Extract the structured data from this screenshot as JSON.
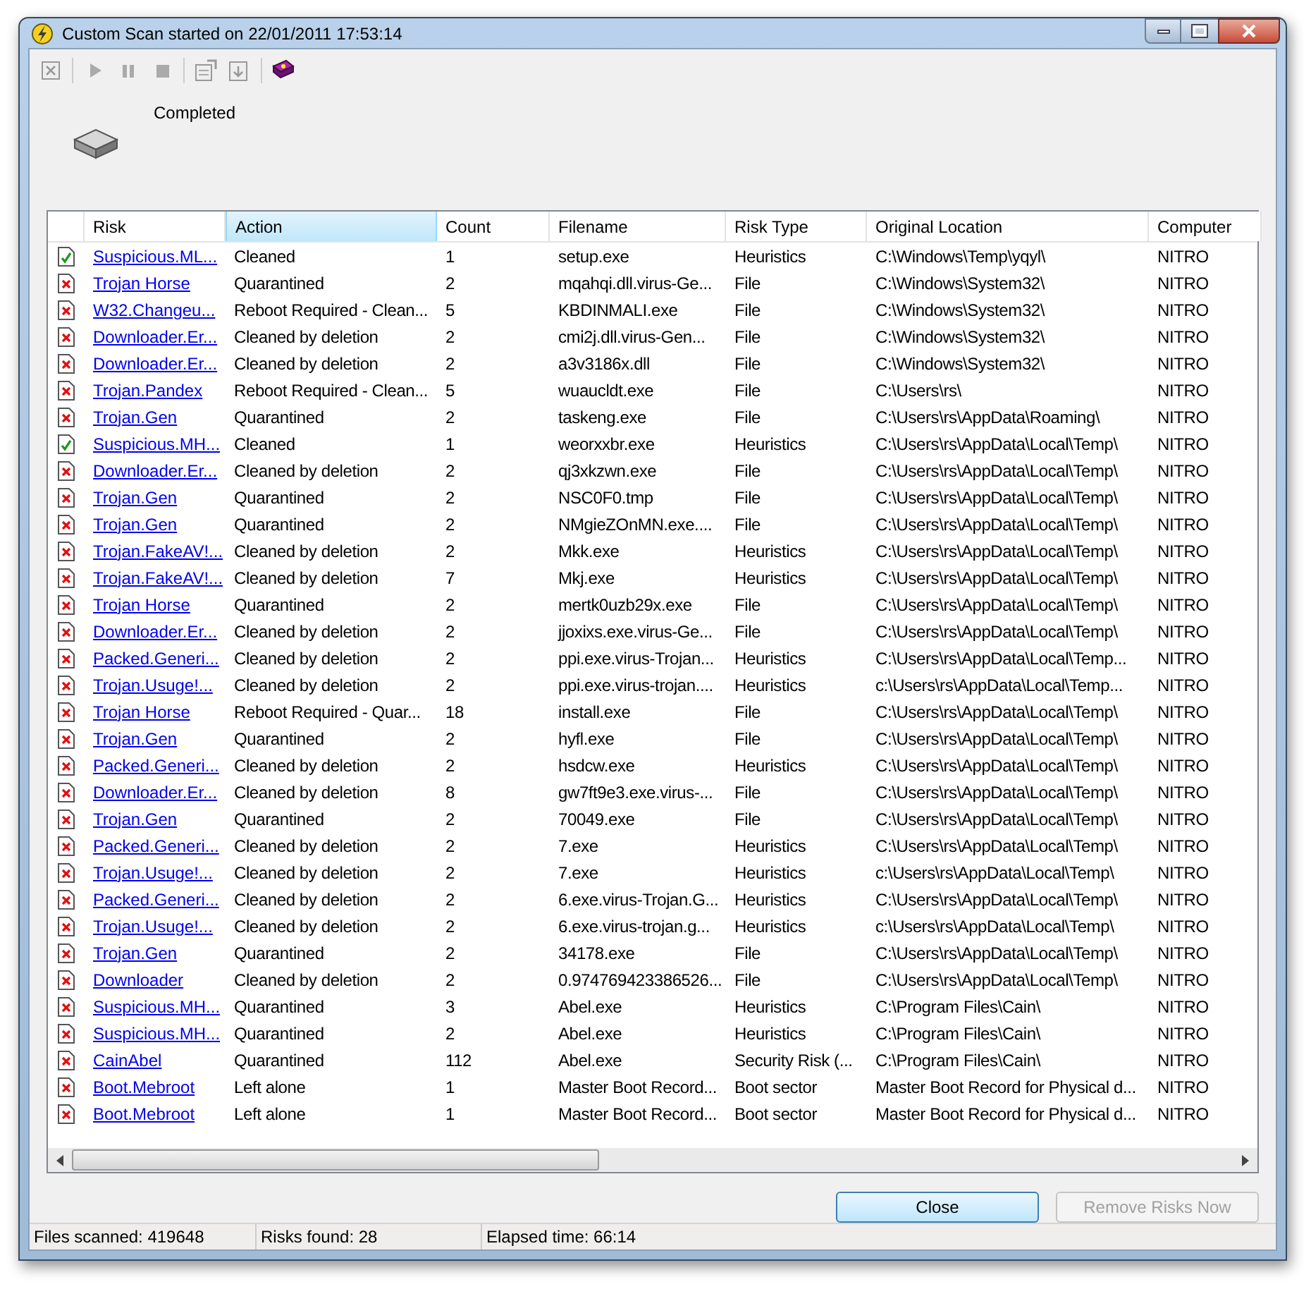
{
  "window": {
    "title": "Custom Scan started on 22/01/2011 17:53:14"
  },
  "status_text": "Completed",
  "table": {
    "columns": [
      {
        "label": "Risk",
        "selected": false
      },
      {
        "label": "Action",
        "selected": true
      },
      {
        "label": "Count",
        "selected": false
      },
      {
        "label": "Filename",
        "selected": false
      },
      {
        "label": "Risk Type",
        "selected": false
      },
      {
        "label": "Original Location",
        "selected": false
      },
      {
        "label": "Computer",
        "selected": false
      }
    ],
    "rows": [
      {
        "kind": "cleaned",
        "risk": "Suspicious.ML...",
        "action": "Cleaned",
        "count": "1",
        "filename": "setup.exe",
        "risk_type": "Heuristics",
        "location": "C:\\Windows\\Temp\\yqyl\\",
        "computer": "NITRO"
      },
      {
        "kind": "threat",
        "risk": "Trojan Horse",
        "action": "Quarantined",
        "count": "2",
        "filename": "mqahqi.dll.virus-Ge...",
        "risk_type": "File",
        "location": "C:\\Windows\\System32\\",
        "computer": "NITRO"
      },
      {
        "kind": "threat",
        "risk": "W32.Changeu...",
        "action": "Reboot Required - Clean...",
        "count": "5",
        "filename": "KBDINMALI.exe",
        "risk_type": "File",
        "location": "C:\\Windows\\System32\\",
        "computer": "NITRO"
      },
      {
        "kind": "threat",
        "risk": "Downloader.Er...",
        "action": "Cleaned by deletion",
        "count": "2",
        "filename": "cmi2j.dll.virus-Gen...",
        "risk_type": "File",
        "location": "C:\\Windows\\System32\\",
        "computer": "NITRO"
      },
      {
        "kind": "threat",
        "risk": "Downloader.Er...",
        "action": "Cleaned by deletion",
        "count": "2",
        "filename": "a3v3186x.dll",
        "risk_type": "File",
        "location": "C:\\Windows\\System32\\",
        "computer": "NITRO"
      },
      {
        "kind": "threat",
        "risk": "Trojan.Pandex",
        "action": "Reboot Required - Clean...",
        "count": "5",
        "filename": "wuaucldt.exe",
        "risk_type": "File",
        "location": "C:\\Users\\rs\\",
        "computer": "NITRO"
      },
      {
        "kind": "threat",
        "risk": "Trojan.Gen",
        "action": "Quarantined",
        "count": "2",
        "filename": "taskeng.exe",
        "risk_type": "File",
        "location": "C:\\Users\\rs\\AppData\\Roaming\\",
        "computer": "NITRO"
      },
      {
        "kind": "cleaned",
        "risk": "Suspicious.MH...",
        "action": "Cleaned",
        "count": "1",
        "filename": "weorxxbr.exe",
        "risk_type": "Heuristics",
        "location": "C:\\Users\\rs\\AppData\\Local\\Temp\\",
        "computer": "NITRO"
      },
      {
        "kind": "threat",
        "risk": "Downloader.Er...",
        "action": "Cleaned by deletion",
        "count": "2",
        "filename": "qj3xkzwn.exe",
        "risk_type": "File",
        "location": "C:\\Users\\rs\\AppData\\Local\\Temp\\",
        "computer": "NITRO"
      },
      {
        "kind": "threat",
        "risk": "Trojan.Gen",
        "action": "Quarantined",
        "count": "2",
        "filename": "NSC0F0.tmp",
        "risk_type": "File",
        "location": "C:\\Users\\rs\\AppData\\Local\\Temp\\",
        "computer": "NITRO"
      },
      {
        "kind": "threat",
        "risk": "Trojan.Gen",
        "action": "Quarantined",
        "count": "2",
        "filename": "NMgieZOnMN.exe....",
        "risk_type": "File",
        "location": "C:\\Users\\rs\\AppData\\Local\\Temp\\",
        "computer": "NITRO"
      },
      {
        "kind": "threat",
        "risk": "Trojan.FakeAV!...",
        "action": "Cleaned by deletion",
        "count": "2",
        "filename": "Mkk.exe",
        "risk_type": "Heuristics",
        "location": "C:\\Users\\rs\\AppData\\Local\\Temp\\",
        "computer": "NITRO"
      },
      {
        "kind": "threat",
        "risk": "Trojan.FakeAV!...",
        "action": "Cleaned by deletion",
        "count": "7",
        "filename": "Mkj.exe",
        "risk_type": "Heuristics",
        "location": "C:\\Users\\rs\\AppData\\Local\\Temp\\",
        "computer": "NITRO"
      },
      {
        "kind": "threat",
        "risk": "Trojan Horse",
        "action": "Quarantined",
        "count": "2",
        "filename": "mertk0uzb29x.exe",
        "risk_type": "File",
        "location": "C:\\Users\\rs\\AppData\\Local\\Temp\\",
        "computer": "NITRO"
      },
      {
        "kind": "threat",
        "risk": "Downloader.Er...",
        "action": "Cleaned by deletion",
        "count": "2",
        "filename": "jjoxixs.exe.virus-Ge...",
        "risk_type": "File",
        "location": "C:\\Users\\rs\\AppData\\Local\\Temp\\",
        "computer": "NITRO"
      },
      {
        "kind": "threat",
        "risk": "Packed.Generi...",
        "action": "Cleaned by deletion",
        "count": "2",
        "filename": "ppi.exe.virus-Trojan...",
        "risk_type": "Heuristics",
        "location": "C:\\Users\\rs\\AppData\\Local\\Temp...",
        "computer": "NITRO"
      },
      {
        "kind": "threat",
        "risk": "Trojan.Usuge!...",
        "action": "Cleaned by deletion",
        "count": "2",
        "filename": "ppi.exe.virus-trojan....",
        "risk_type": "Heuristics",
        "location": "c:\\Users\\rs\\AppData\\Local\\Temp...",
        "computer": "NITRO"
      },
      {
        "kind": "threat",
        "risk": "Trojan Horse",
        "action": "Reboot Required - Quar...",
        "count": "18",
        "filename": "install.exe",
        "risk_type": "File",
        "location": "C:\\Users\\rs\\AppData\\Local\\Temp\\",
        "computer": "NITRO"
      },
      {
        "kind": "threat",
        "risk": "Trojan.Gen",
        "action": "Quarantined",
        "count": "2",
        "filename": "hyfl.exe",
        "risk_type": "File",
        "location": "C:\\Users\\rs\\AppData\\Local\\Temp\\",
        "computer": "NITRO"
      },
      {
        "kind": "threat",
        "risk": "Packed.Generi...",
        "action": "Cleaned by deletion",
        "count": "2",
        "filename": "hsdcw.exe",
        "risk_type": "Heuristics",
        "location": "C:\\Users\\rs\\AppData\\Local\\Temp\\",
        "computer": "NITRO"
      },
      {
        "kind": "threat",
        "risk": "Downloader.Er...",
        "action": "Cleaned by deletion",
        "count": "8",
        "filename": "gw7ft9e3.exe.virus-...",
        "risk_type": "File",
        "location": "C:\\Users\\rs\\AppData\\Local\\Temp\\",
        "computer": "NITRO"
      },
      {
        "kind": "threat",
        "risk": "Trojan.Gen",
        "action": "Quarantined",
        "count": "2",
        "filename": "70049.exe",
        "risk_type": "File",
        "location": "C:\\Users\\rs\\AppData\\Local\\Temp\\",
        "computer": "NITRO"
      },
      {
        "kind": "threat",
        "risk": "Packed.Generi...",
        "action": "Cleaned by deletion",
        "count": "2",
        "filename": "7.exe",
        "risk_type": "Heuristics",
        "location": "C:\\Users\\rs\\AppData\\Local\\Temp\\",
        "computer": "NITRO"
      },
      {
        "kind": "threat",
        "risk": "Trojan.Usuge!...",
        "action": "Cleaned by deletion",
        "count": "2",
        "filename": "7.exe",
        "risk_type": "Heuristics",
        "location": "c:\\Users\\rs\\AppData\\Local\\Temp\\",
        "computer": "NITRO"
      },
      {
        "kind": "threat",
        "risk": "Packed.Generi...",
        "action": "Cleaned by deletion",
        "count": "2",
        "filename": "6.exe.virus-Trojan.G...",
        "risk_type": "Heuristics",
        "location": "C:\\Users\\rs\\AppData\\Local\\Temp\\",
        "computer": "NITRO"
      },
      {
        "kind": "threat",
        "risk": "Trojan.Usuge!...",
        "action": "Cleaned by deletion",
        "count": "2",
        "filename": "6.exe.virus-trojan.g...",
        "risk_type": "Heuristics",
        "location": "c:\\Users\\rs\\AppData\\Local\\Temp\\",
        "computer": "NITRO"
      },
      {
        "kind": "threat",
        "risk": "Trojan.Gen",
        "action": "Quarantined",
        "count": "2",
        "filename": "34178.exe",
        "risk_type": "File",
        "location": "C:\\Users\\rs\\AppData\\Local\\Temp\\",
        "computer": "NITRO"
      },
      {
        "kind": "threat",
        "risk": "Downloader",
        "action": "Cleaned by deletion",
        "count": "2",
        "filename": "0.974769423386526...",
        "risk_type": "File",
        "location": "C:\\Users\\rs\\AppData\\Local\\Temp\\",
        "computer": "NITRO"
      },
      {
        "kind": "threat",
        "risk": "Suspicious.MH...",
        "action": "Quarantined",
        "count": "3",
        "filename": "Abel.exe",
        "risk_type": "Heuristics",
        "location": "C:\\Program Files\\Cain\\",
        "computer": "NITRO"
      },
      {
        "kind": "threat",
        "risk": "Suspicious.MH...",
        "action": "Quarantined",
        "count": "2",
        "filename": "Abel.exe",
        "risk_type": "Heuristics",
        "location": "C:\\Program Files\\Cain\\",
        "computer": "NITRO"
      },
      {
        "kind": "threat",
        "risk": "CainAbel",
        "action": "Quarantined",
        "count": "112",
        "filename": "Abel.exe",
        "risk_type": "Security Risk (...",
        "location": "C:\\Program Files\\Cain\\",
        "computer": "NITRO"
      },
      {
        "kind": "threat",
        "risk": "Boot.Mebroot",
        "action": "Left alone",
        "count": "1",
        "filename": "Master Boot Record...",
        "risk_type": "Boot sector",
        "location": "Master Boot Record for Physical d...",
        "computer": "NITRO"
      },
      {
        "kind": "threat",
        "risk": "Boot.Mebroot",
        "action": "Left alone",
        "count": "1",
        "filename": "Master Boot Record...",
        "risk_type": "Boot sector",
        "location": "Master Boot Record for Physical d...",
        "computer": "NITRO"
      }
    ]
  },
  "buttons": [
    {
      "label": "Close",
      "disabled": false
    },
    {
      "label": "Remove Risks Now",
      "disabled": true
    }
  ],
  "status_bar": [
    "Files scanned: 419648",
    "Risks found: 28",
    "Elapsed time: 66:14"
  ]
}
